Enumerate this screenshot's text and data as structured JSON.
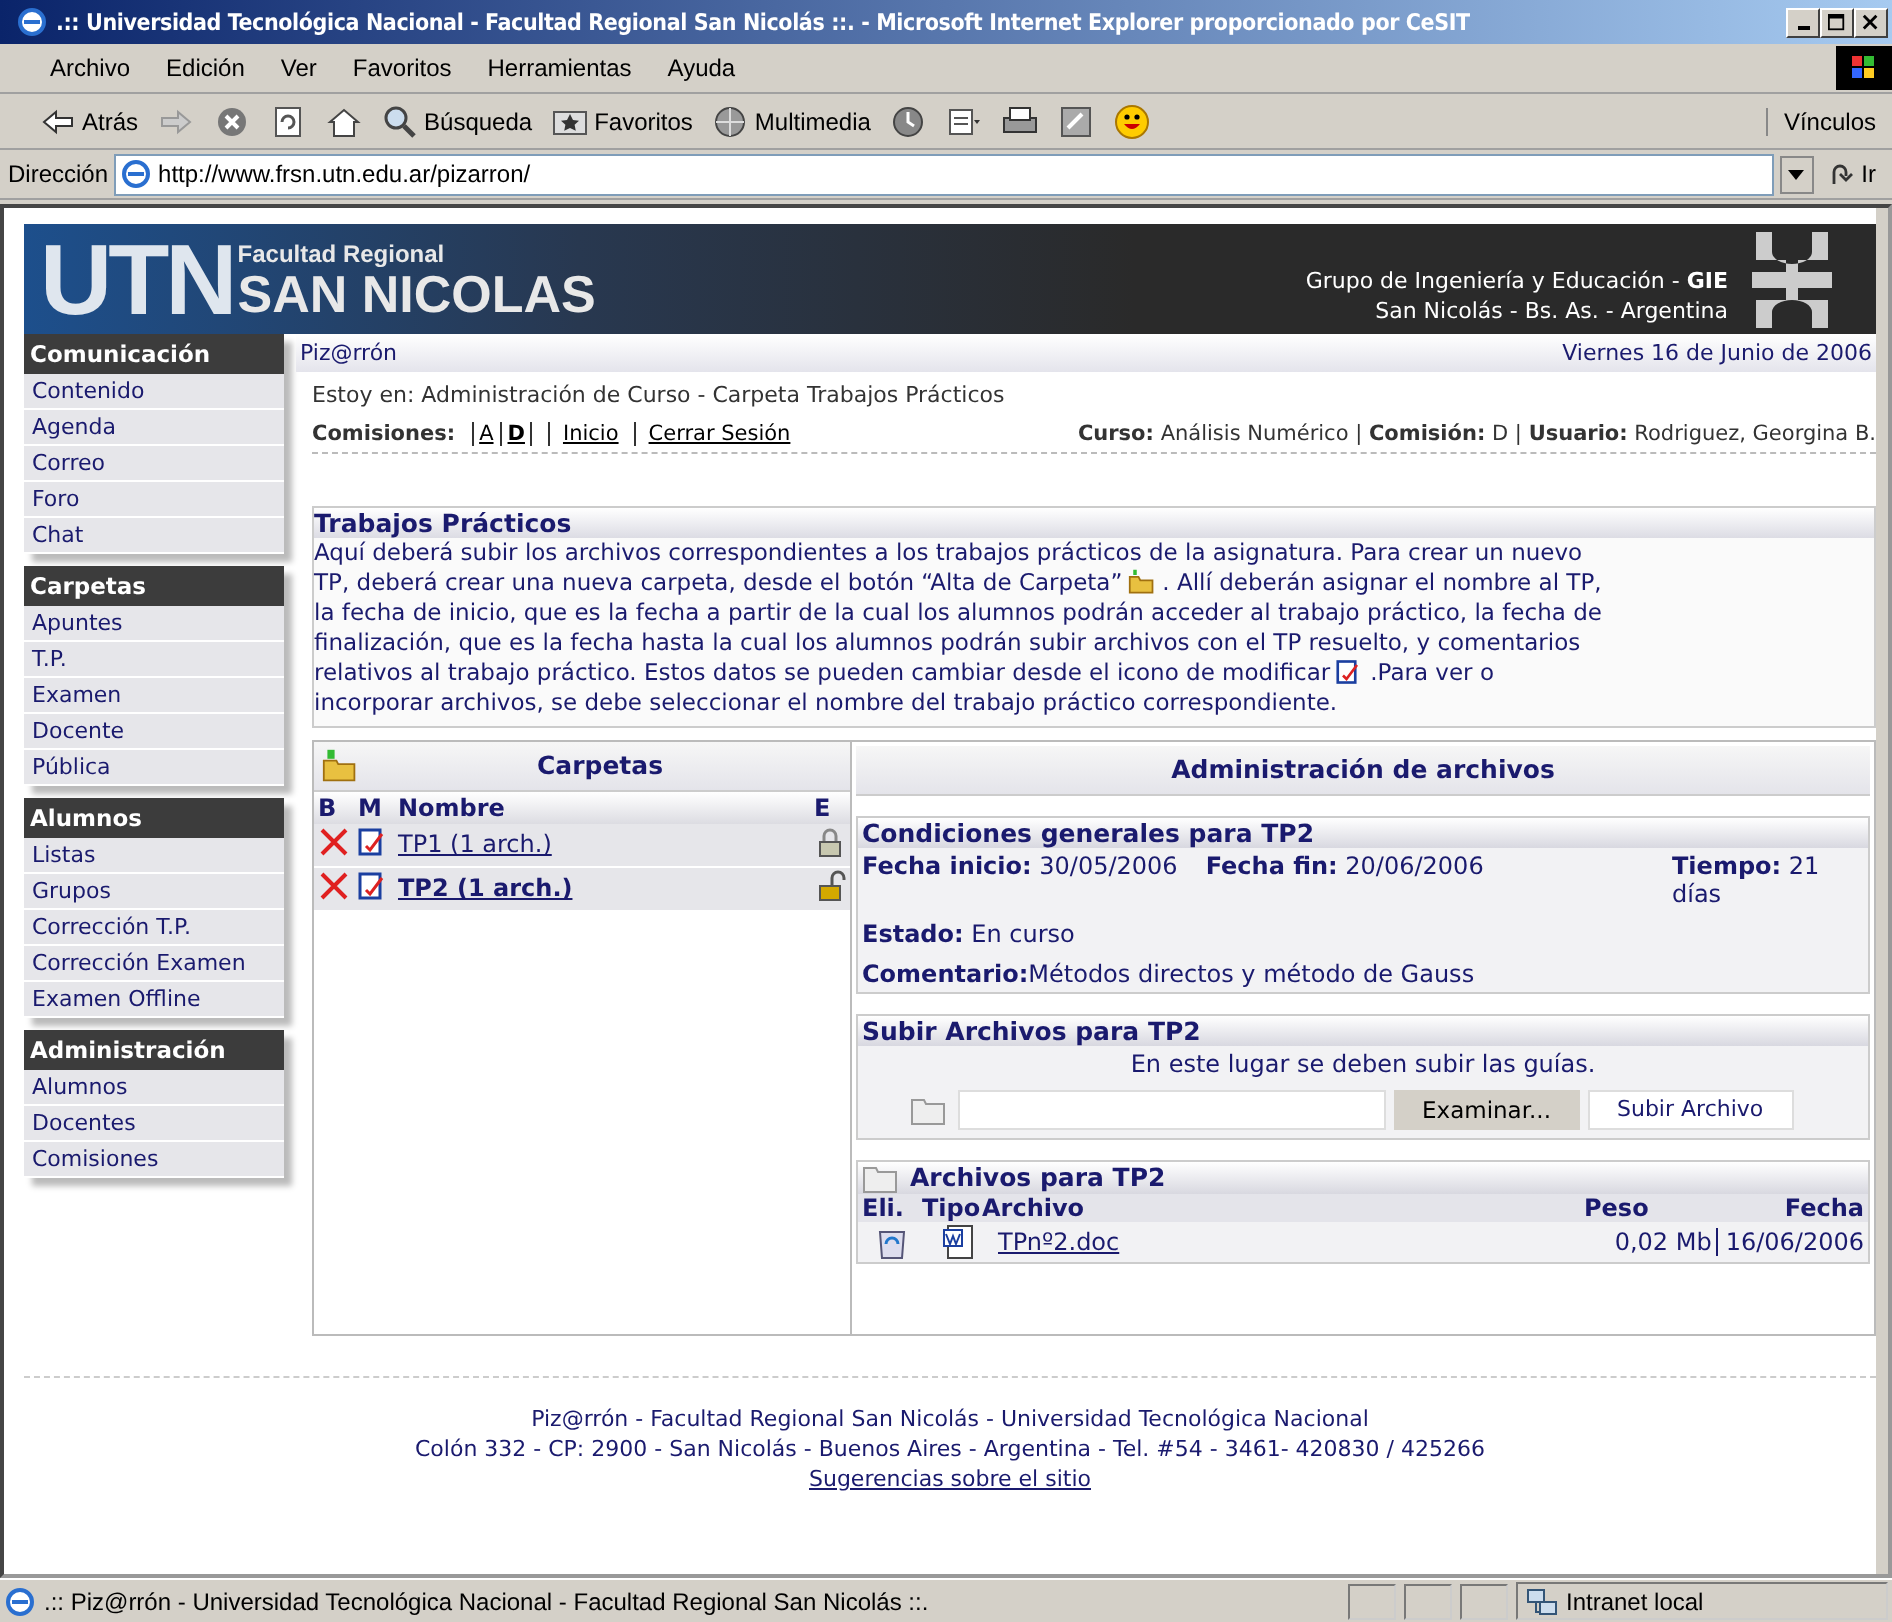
{
  "window": {
    "title": ".:: Universidad Tecnológica Nacional - Facultad Regional San Nicolás ::. - Microsoft Internet Explorer proporcionado por CeSIT"
  },
  "menu": [
    "Archivo",
    "Edición",
    "Ver",
    "Favoritos",
    "Herramientas",
    "Ayuda"
  ],
  "toolbar": [
    {
      "kind": "back",
      "label": "Atrás"
    },
    {
      "kind": "forward"
    },
    {
      "kind": "stop"
    },
    {
      "kind": "refresh"
    },
    {
      "kind": "home"
    },
    {
      "kind": "search",
      "label": "Búsqueda"
    },
    {
      "kind": "favorites",
      "label": "Favoritos"
    },
    {
      "kind": "media",
      "label": "Multimedia"
    },
    {
      "kind": "history"
    },
    {
      "kind": "mail"
    },
    {
      "kind": "print"
    },
    {
      "kind": "edit"
    },
    {
      "kind": "messenger"
    }
  ],
  "links_label": "Vínculos",
  "address": {
    "label": "Dirección",
    "value": "http://www.frsn.utn.edu.ar/pizarron/",
    "go": "Ir"
  },
  "banner": {
    "logo": "UTN",
    "subtitle": "Facultad Regional",
    "title": "SAN NICOLAS",
    "group": "Grupo de Ingeniería y Educación - **GIE**",
    "location": "San Nicolás - Bs. As. - Argentina"
  },
  "sidebar": [
    {
      "title": "Comunicación",
      "items": [
        "Contenido",
        "Agenda",
        "Correo",
        "Foro",
        "Chat"
      ]
    },
    {
      "title": "Carpetas",
      "items": [
        "Apuntes",
        "T.P.",
        "Examen",
        "Docente",
        "Pública"
      ]
    },
    {
      "title": "Alumnos",
      "items": [
        "Listas",
        "Grupos",
        "Corrección T.P.",
        "Corrección Examen",
        "Examen Offline"
      ]
    },
    {
      "title": "Administración",
      "items": [
        "Alumnos",
        "Docentes",
        "Comisiones"
      ]
    }
  ],
  "topbar": {
    "site": "Piz@rrón",
    "date": "Viernes 16 de Junio de 2006"
  },
  "breadcrumb": "Estoy en: Administración de Curso - Carpeta Trabajos Prácticos",
  "commissions": {
    "label": "Comisiones:",
    "items": [
      {
        "label": "A",
        "selected": false
      },
      {
        "label": "D",
        "selected": true
      }
    ],
    "links": [
      "Inicio",
      "Cerrar Sesión"
    ],
    "info": "**Curso:** Análisis Numérico | **Comisión:** D | **Usuario:** Rodriguez, Georgina B."
  },
  "intro": {
    "title": "Trabajos Prácticos",
    "lines": [
      [
        {
          "kind": "text",
          "text": "Aquí deberá subir los archivos correspondientes a los trabajos prácticos de la asignatura. Para crear un nuevo"
        }
      ],
      [
        {
          "kind": "text",
          "text": "TP, deberá crear una nueva carpeta, desde el botón “Alta de Carpeta”"
        },
        {
          "kind": "folder"
        },
        {
          "kind": "text",
          "text": ". Allí deberán asignar el nombre al TP,"
        }
      ],
      [
        {
          "kind": "text",
          "text": "la fecha de inicio, que es la fecha a partir de la cual los alumnos podrán acceder al trabajo práctico, la fecha de"
        }
      ],
      [
        {
          "kind": "text",
          "text": "finalización, que es la fecha hasta la cual los alumnos podrán subir archivos con el TP resuelto, y comentarios"
        }
      ],
      [
        {
          "kind": "text",
          "text": "relativos al trabajo práctico. Estos datos se pueden cambiar desde el icono de modificar"
        },
        {
          "kind": "edit"
        },
        {
          "kind": "text",
          "text": ".Para ver o"
        }
      ],
      [
        {
          "kind": "text",
          "text": "incorporar archivos, se debe seleccionar el nombre del trabajo práctico correspondiente."
        }
      ]
    ]
  },
  "folders": {
    "title": "Carpetas",
    "columns": [
      "B",
      "M",
      "Nombre",
      "E"
    ],
    "rows": [
      {
        "name": "TP1 (1 arch.)",
        "selected": false,
        "locked": true
      },
      {
        "name": "TP2 (1 arch.)",
        "selected": true,
        "locked": false
      }
    ]
  },
  "admin": {
    "title": "Administración de archivos",
    "conditions": {
      "title": "Condiciones generales para TP2",
      "start": "**Fecha inicio:** 30/05/2006",
      "end": "**Fecha fin:** 20/06/2006",
      "duration": "**Tiempo:** 21 días",
      "status": "**Estado:** En curso",
      "comment": "**Comentario:**Métodos directos y método de Gauss"
    },
    "upload": {
      "title": "Subir Archivos para TP2",
      "hint": "En este lugar se deben subir las guías.",
      "browse": "Examinar...",
      "submit": "Subir Archivo"
    },
    "files": {
      "title": "Archivos para TP2",
      "columns": [
        "Eli.",
        "Tipo",
        "Archivo",
        "Peso",
        "Fecha"
      ],
      "rows": [
        {
          "name": "TPnº2.doc",
          "size": "0,02 Mb",
          "date": "16/06/2006"
        }
      ]
    }
  },
  "footer": {
    "lines": [
      "Piz@rrón - Facultad Regional San Nicolás - Universidad Tecnológica Nacional",
      "Colón 332 - CP: 2900 - San Nicolás - Buenos Aires - Argentina - Tel. #54 - 3461- 420830 / 425266"
    ],
    "link": "Sugerencias sobre el sitio"
  },
  "status_bar": {
    "text": ".:: Piz@rrón - Universidad Tecnológica Nacional - Facultad Regional San Nicolás ::.",
    "zone": "Intranet local"
  }
}
